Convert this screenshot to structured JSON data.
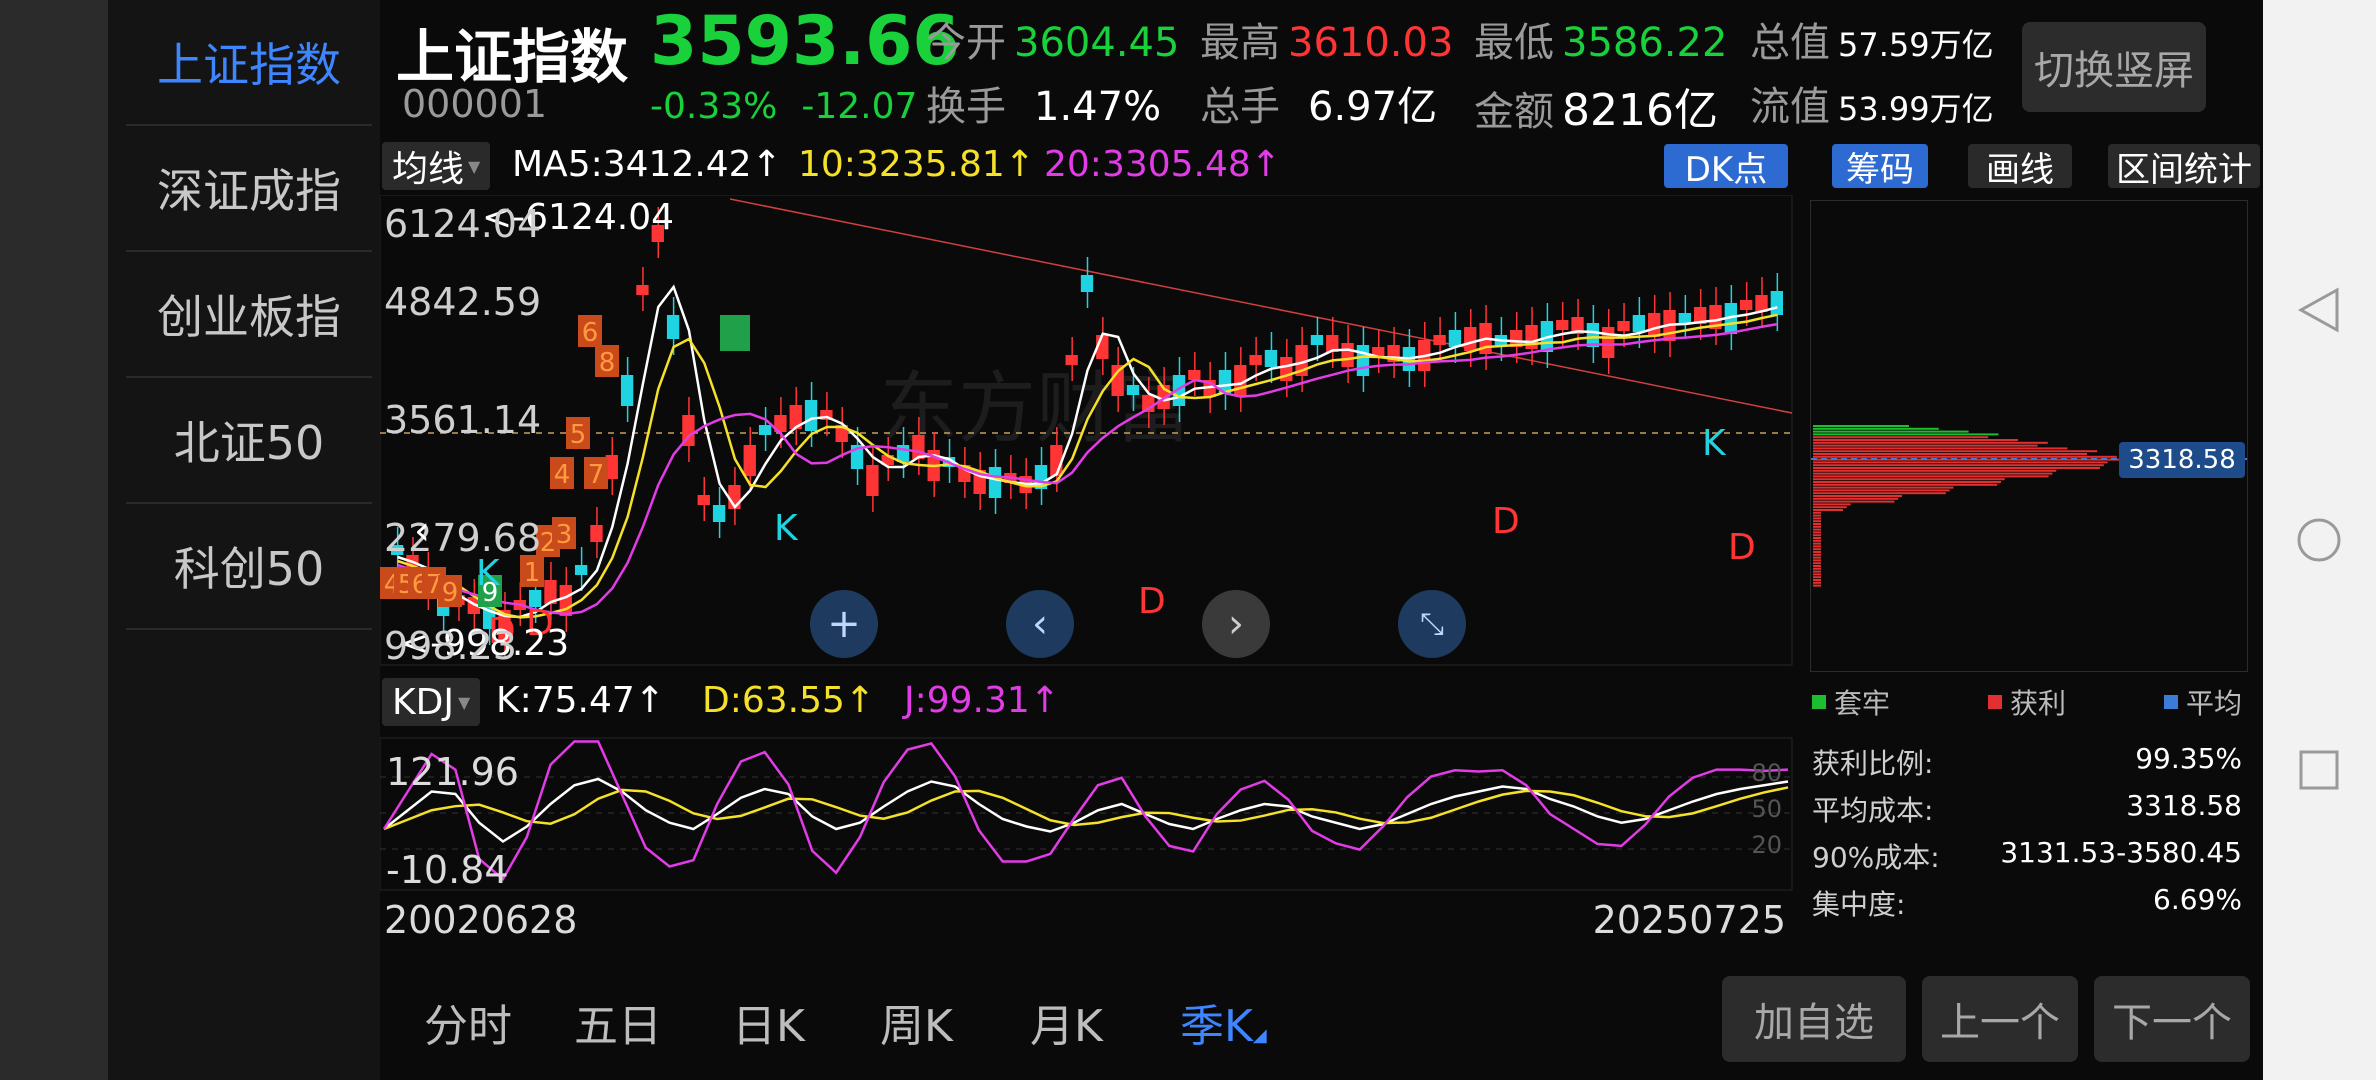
{
  "sidebar": {
    "items": [
      {
        "label": "上证指数",
        "active": true
      },
      {
        "label": "深证成指",
        "active": false
      },
      {
        "label": "创业板指",
        "active": false
      },
      {
        "label": "北证50",
        "active": false
      },
      {
        "label": "科创50",
        "active": false
      }
    ]
  },
  "header": {
    "name": "上证指数",
    "code": "000001",
    "price": "3593.66",
    "change_pct": "-0.33%",
    "change": "-12.07",
    "open_label": "今开",
    "open": "3604.45",
    "high_label": "最高",
    "high": "3610.03",
    "low_label": "最低",
    "low": "3586.22",
    "total_value_label": "总值",
    "total_value": "57.59万亿",
    "turnover_label": "换手",
    "turnover": "1.47%",
    "volume_label": "总手",
    "volume": "6.97亿",
    "amount_label": "金额",
    "amount": "8216亿",
    "float_value_label": "流值",
    "float_value": "53.99万亿",
    "toggle_label": "切换竖屏"
  },
  "ma": {
    "selector": "均线",
    "ma5": "MA5:3412.42↑",
    "ma10": "10:3235.81↑",
    "ma20": "20:3305.48↑",
    "colors": {
      "ma5": "#ffffff",
      "ma10": "#f5e12a",
      "ma20": "#e23ce6"
    }
  },
  "tools": {
    "dk": "DK点",
    "chips": "筹码",
    "draw": "画线",
    "range": "区间统计"
  },
  "price_chart": {
    "y_labels": [
      "6124.04",
      "4842.59",
      "3561.14",
      "2279.68",
      "998.23"
    ],
    "max_annot": "<-6124.04",
    "min_annot": "<-998.23",
    "marks": [
      {
        "t": "K",
        "color": "#1fd4e0"
      },
      {
        "t": "D",
        "color": "#ff3535"
      },
      {
        "t": "K",
        "color": "#1fd4e0"
      },
      {
        "t": "D",
        "color": "#ff3535"
      },
      {
        "t": "D",
        "color": "#ff3535"
      },
      {
        "t": "K",
        "color": "#1fd4e0"
      },
      {
        "t": "D",
        "color": "#ff3535"
      },
      {
        "t": "D",
        "color": "#ff3535"
      }
    ],
    "count_badges": [
      "6",
      "8",
      "5",
      "4",
      "7",
      "2",
      "3",
      "1",
      "9",
      "4",
      "5",
      "6",
      "7",
      "9"
    ],
    "start_date": "20020628",
    "end_date": "20250725"
  },
  "chip_dist": {
    "cost_tag": "3318.58",
    "legend": [
      {
        "label": "套牢",
        "color": "#1cbd2e"
      },
      {
        "label": "获利",
        "color": "#e03030"
      },
      {
        "label": "平均",
        "color": "#3d7bd8"
      }
    ],
    "stats": [
      {
        "label": "获利比例:",
        "value": "99.35%"
      },
      {
        "label": "平均成本:",
        "value": "3318.58"
      },
      {
        "label": "90%成本:",
        "value": "3131.53-3580.45"
      },
      {
        "label": "集中度:",
        "value": "6.69%"
      }
    ]
  },
  "kdj": {
    "selector": "KDJ",
    "k": "K:75.47↑",
    "d": "D:63.55↑",
    "j": "J:99.31↑",
    "y_labels": [
      "121.96",
      "-10.84"
    ],
    "right_labels": [
      "80",
      "50",
      "20"
    ]
  },
  "tabs": [
    {
      "label": "分时",
      "active": false
    },
    {
      "label": "五日",
      "active": false
    },
    {
      "label": "日K",
      "active": false
    },
    {
      "label": "周K",
      "active": false
    },
    {
      "label": "月K",
      "active": false
    },
    {
      "label": "季K",
      "active": true
    }
  ],
  "bottom_buttons": {
    "add": "加自选",
    "prev": "上一个",
    "next": "下一个"
  },
  "watermark": "东方财富"
}
